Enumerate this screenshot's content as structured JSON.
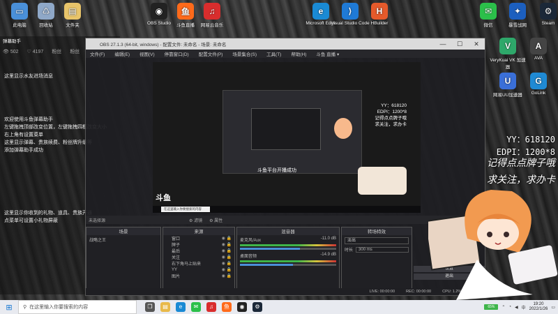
{
  "desktop": {
    "top_icons": [
      {
        "label": "此电脑",
        "color": "#4a90d9",
        "glyph": "▭"
      },
      {
        "label": "回收站",
        "color": "#8fa8c8",
        "glyph": "♺"
      },
      {
        "label": "文件夹",
        "color": "#e8c46a",
        "glyph": "▤"
      },
      {
        "label": "OBS Studio",
        "color": "#222",
        "glyph": "◉"
      },
      {
        "label": "斗鱼直播",
        "color": "#ff6a1a",
        "glyph": "鱼"
      },
      {
        "label": "网易云音乐",
        "color": "#d92d2d",
        "glyph": "♫"
      },
      {
        "label": "Microsoft Edge",
        "color": "#1a8ad4",
        "glyph": "e"
      },
      {
        "label": "Visual Studio Code",
        "color": "#1f7ad6",
        "glyph": "⟩"
      },
      {
        "label": "HBuilder",
        "color": "#e55a2b",
        "glyph": "H"
      },
      {
        "label": "微信",
        "color": "#2bc04a",
        "glyph": "✉"
      },
      {
        "label": "暴雪战网",
        "color": "#1c5fbf",
        "glyph": "✦"
      },
      {
        "label": "Steam",
        "color": "#1b2838",
        "glyph": "⚙"
      }
    ],
    "right_icons": [
      {
        "label": "VeryKuai VK 加速器",
        "color": "#2ea86a",
        "glyph": "V"
      },
      {
        "label": "AVA",
        "color": "#444",
        "glyph": "A"
      },
      {
        "label": "网易UU加速器",
        "color": "#3a6fd8",
        "glyph": "U"
      },
      {
        "label": "GoLink",
        "color": "#1f8ad4",
        "glyph": "G"
      }
    ]
  },
  "douyu_panel": {
    "title": "弹幕助手",
    "stats": [
      "👁 502",
      "♡ 4197",
      "粉丝",
      "粉丝"
    ],
    "message_area": "这里显示水友进场消息",
    "welcome_lines": [
      "欢迎使用斗鱼弹幕助手",
      "左键拖拽顶部改变位置，左键拖拽四框改变大小",
      "右上角有设置菜单",
      "这里显示弹幕、贵族续费、粉丝牌升级等",
      "添加弹幕助手成功"
    ],
    "gift_lines": [
      "这里显示你收到的礼物、道具、贵族开通",
      "点菜单可设置小礼物屏蔽"
    ]
  },
  "obs": {
    "title": "OBS 27.1.3 (64-bit, windows) - 配置文件: 未命名 - 场景: 未命名",
    "menu": [
      "文件(F)",
      "编辑(E)",
      "视图(V)",
      "停靠窗口(D)",
      "配置文件(P)",
      "场景集合(S)",
      "工具(T)",
      "帮助(H)",
      "斗鱼 直播 ▾"
    ],
    "window_controls": [
      "—",
      "☐",
      "✕"
    ],
    "preview": {
      "caption": "斗鱼平台开播成功",
      "search_placeholder": "在这里输入你要搜索的内容",
      "yy_line": "YY：618120",
      "edpi_line": "EDPI：1200*8",
      "script1": "记得点点牌子哦",
      "script2": "求关注，求办卡",
      "logo": "斗鱼"
    },
    "scene_bar": {
      "filter_label": "滤镜",
      "props_label": "属性",
      "no_source": "未选择源"
    },
    "docks": {
      "scenes": {
        "title": "场景",
        "items": [
          "战略之王"
        ]
      },
      "sources": {
        "title": "来源",
        "items": [
          "窗口",
          "牌子",
          "最后",
          "关注",
          "右下角马上贴来",
          "YY",
          "图片"
        ]
      },
      "mixer": {
        "title": "混音器",
        "tracks": [
          {
            "name": "麦克风/Aux",
            "db": "-11.0 dB",
            "level": 0.62
          },
          {
            "name": "桌面音频",
            "db": "-14.9 dB",
            "level": 0.55
          }
        ]
      },
      "transitions": {
        "title": "转场特效",
        "type": "淡出",
        "duration_label": "时长",
        "duration": "300 ms"
      },
      "controls": {
        "buttons": [
          "设置",
          "退出"
        ]
      }
    },
    "status": {
      "live": "LIVE: 00:00:00",
      "rec": "REC: 00:00:00",
      "cpu": "CPU: 1.2%, 60.00 fps"
    },
    "dock_footer_icons": [
      "+",
      "—",
      "⌃",
      "⌄"
    ]
  },
  "overlay": {
    "yy": "YY：618120",
    "edpi": "EDPI：1200*8",
    "line1": "记得点点牌子哦",
    "line2": "求关注，求办卡",
    "douyu_logo": "斗鱼"
  },
  "taskbar": {
    "search_placeholder": "在这里输入你要搜索的内容",
    "apps": [
      {
        "name": "task-view",
        "color": "#555",
        "glyph": "❒"
      },
      {
        "name": "explorer",
        "color": "#e8b949",
        "glyph": "▤"
      },
      {
        "name": "edge",
        "color": "#1a8ad4",
        "glyph": "e"
      },
      {
        "name": "wechat",
        "color": "#2bc04a",
        "glyph": "✉"
      },
      {
        "name": "netease",
        "color": "#d92d2d",
        "glyph": "♫"
      },
      {
        "name": "douyu",
        "color": "#ff6a1a",
        "glyph": "鱼"
      },
      {
        "name": "obs",
        "color": "#222",
        "glyph": "◉"
      },
      {
        "name": "steam",
        "color": "#1b2838",
        "glyph": "⚙"
      }
    ],
    "battery": "65%",
    "time": "19:20",
    "date": "2022/1/26",
    "lang": "中"
  }
}
